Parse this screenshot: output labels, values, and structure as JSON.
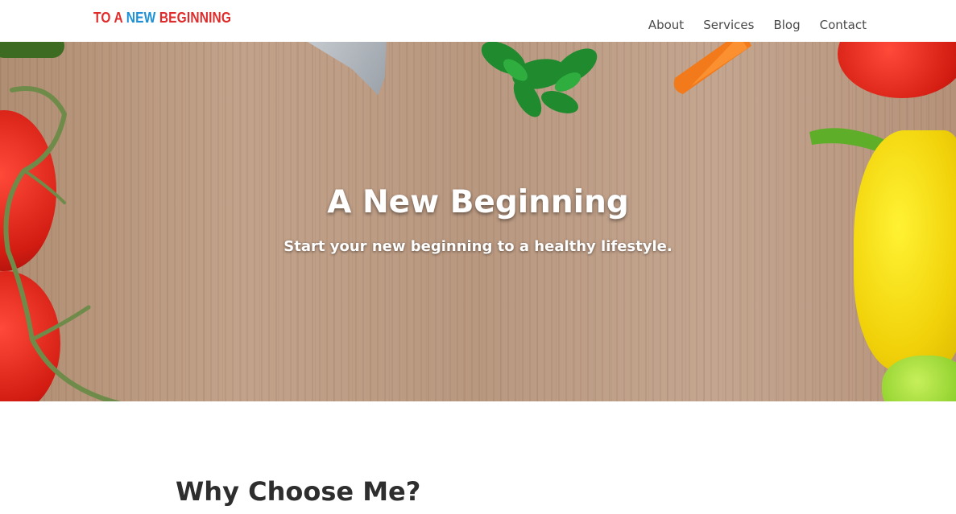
{
  "header": {
    "logo": {
      "part1": "TO A",
      "part2": "NEW",
      "part3": "BEGINNING"
    },
    "nav": [
      {
        "label": "About"
      },
      {
        "label": "Services"
      },
      {
        "label": "Blog"
      },
      {
        "label": "Contact"
      }
    ]
  },
  "hero": {
    "title": "A New Beginning",
    "subtitle": "Start your new beginning to a healthy lifestyle."
  },
  "section": {
    "title": "Why Choose Me?"
  },
  "colors": {
    "logo_red": "#e02b2b",
    "logo_blue": "#1e90d6",
    "nav_text": "#4a4a4a",
    "heading_text": "#2e2e2e"
  }
}
